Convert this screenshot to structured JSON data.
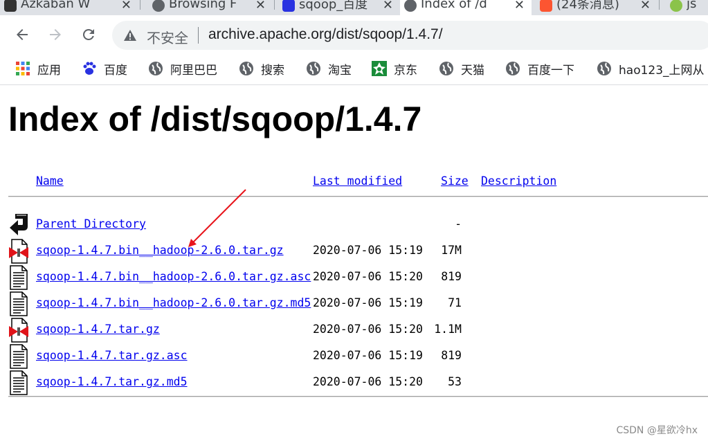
{
  "tabs": [
    {
      "title": "Azkaban W",
      "favicon_color": "#333333",
      "active": false
    },
    {
      "title": "Browsing F",
      "favicon_color": "#5f6368",
      "active": false
    },
    {
      "title": "sqoop_百度",
      "favicon_color": "#2932e1",
      "active": false
    },
    {
      "title": "Index of /d",
      "favicon_color": "#5f6368",
      "active": true
    },
    {
      "title": "(24条消息)",
      "favicon_color": "#fc5531",
      "active": false
    },
    {
      "title": "js",
      "favicon_color": "#8bc34a",
      "active": false
    }
  ],
  "toolbar": {
    "security_label": "不安全",
    "url": "archive.apache.org/dist/sqoop/1.4.7/"
  },
  "bookmarks": [
    {
      "label": "应用",
      "icon": "apps-grid-icon"
    },
    {
      "label": "百度",
      "icon": "baidu-paw-icon"
    },
    {
      "label": "阿里巴巴",
      "icon": "globe-icon"
    },
    {
      "label": "搜索",
      "icon": "globe-icon"
    },
    {
      "label": "淘宝",
      "icon": "globe-icon"
    },
    {
      "label": "京东",
      "icon": "jd-icon"
    },
    {
      "label": "天猫",
      "icon": "globe-icon"
    },
    {
      "label": "百度一下",
      "icon": "globe-icon"
    },
    {
      "label": "hao123_上网从",
      "icon": "globe-icon"
    }
  ],
  "page": {
    "title": "Index of /dist/sqoop/1.4.7",
    "headers": {
      "name": "Name",
      "last_modified": "Last modified",
      "size": "Size",
      "description": "Description"
    },
    "rows": [
      {
        "name": "Parent Directory",
        "modified": "",
        "size": "-",
        "icon": "back-arrow-icon"
      },
      {
        "name": "sqoop-1.4.7.bin__hadoop-2.6.0.tar.gz",
        "modified": "2020-07-06 15:19",
        "size": "17M",
        "icon": "compressed-file-icon"
      },
      {
        "name": "sqoop-1.4.7.bin__hadoop-2.6.0.tar.gz.asc",
        "modified": "2020-07-06 15:20",
        "size": "819",
        "icon": "text-file-icon"
      },
      {
        "name": "sqoop-1.4.7.bin__hadoop-2.6.0.tar.gz.md5",
        "modified": "2020-07-06 15:19",
        "size": "71",
        "icon": "text-file-icon"
      },
      {
        "name": "sqoop-1.4.7.tar.gz",
        "modified": "2020-07-06 15:20",
        "size": "1.1M",
        "icon": "compressed-file-icon"
      },
      {
        "name": "sqoop-1.4.7.tar.gz.asc",
        "modified": "2020-07-06 15:19",
        "size": "819",
        "icon": "text-file-icon"
      },
      {
        "name": "sqoop-1.4.7.tar.gz.md5",
        "modified": "2020-07-06 15:20",
        "size": "53",
        "icon": "text-file-icon"
      }
    ]
  },
  "watermark": "CSDN @星欲冷hx",
  "annotation_color": "#e8141b"
}
